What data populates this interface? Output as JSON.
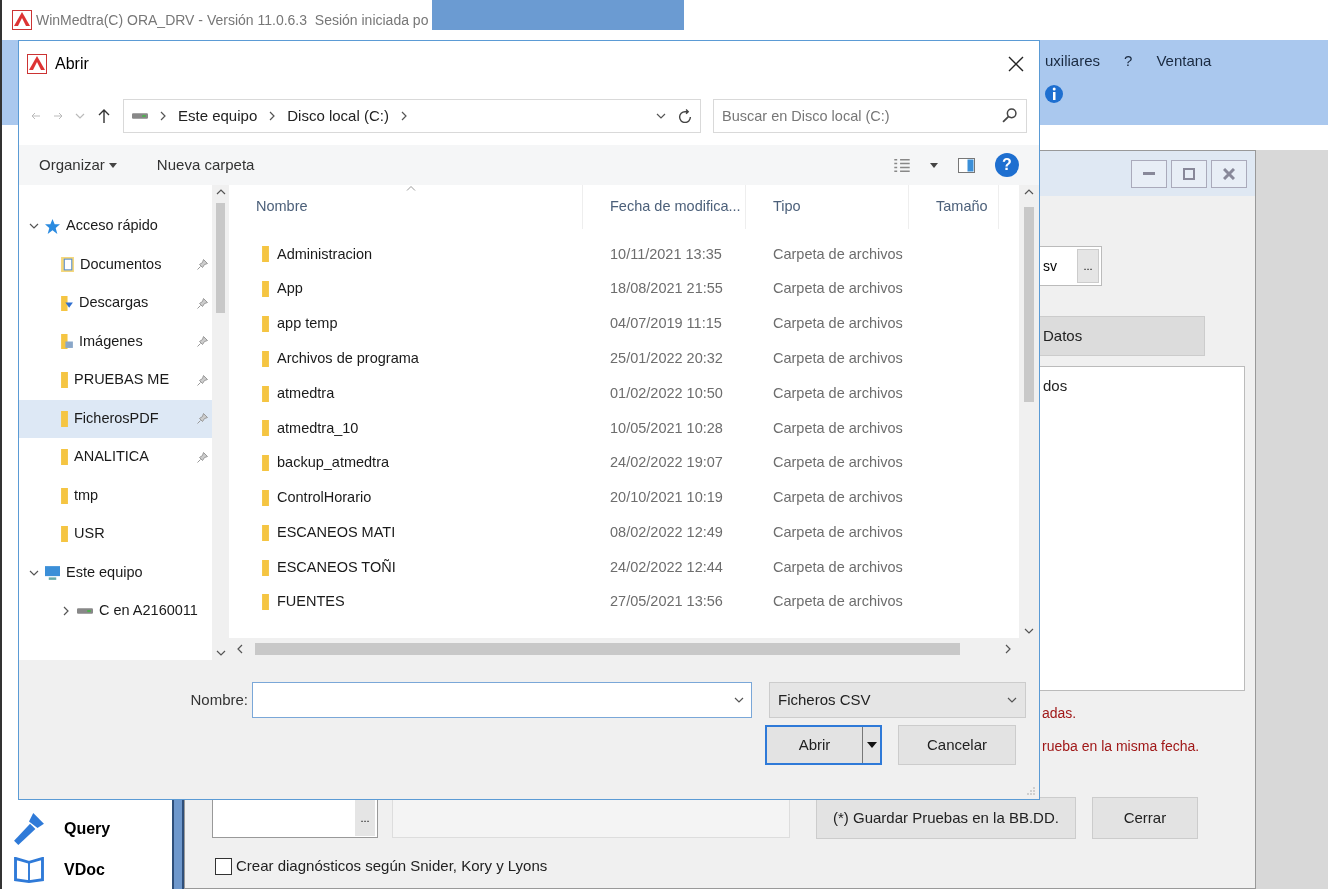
{
  "app": {
    "title": "WinMedtra(C) ORA_DRV - Versión 11.0.6.3  Sesión iniciada po",
    "menu": [
      "uxiliares",
      "?",
      "Ventana"
    ],
    "sidebar": [
      {
        "kind": "query",
        "label": "Query"
      },
      {
        "kind": "vdoc",
        "label": "VDoc"
      }
    ],
    "inner": {
      "file_field": "sv",
      "browse": "...",
      "datos": "Datos",
      "list_header": "dos",
      "notes": [
        "adas.",
        "rueba en la misma fecha."
      ],
      "bottom_browse": "...",
      "save_button": "(*) Guardar Pruebas en la BB.DD.",
      "close_button": "Cerrar",
      "checkbox": {
        "label": "Crear diagnósticos según Snider, Kory y Lyons",
        "checked": false
      }
    }
  },
  "dialog": {
    "title": "Abrir",
    "breadcrumb": [
      "Este equipo",
      "Disco local (C:)"
    ],
    "search": {
      "placeholder": "Buscar en Disco local (C:)"
    },
    "toolbar": [
      "Organizar",
      "Nueva carpeta"
    ],
    "nav": [
      {
        "label": "Acceso rápido",
        "kind": "star",
        "expanded": true,
        "children": [
          {
            "label": "Documentos",
            "kind": "documents",
            "pinned": true,
            "selected": false
          },
          {
            "label": "Descargas",
            "kind": "downloads",
            "pinned": true,
            "selected": false
          },
          {
            "label": "Imágenes",
            "kind": "pictures",
            "pinned": true,
            "selected": false
          },
          {
            "label": "PRUEBAS ME",
            "kind": "folder",
            "pinned": true,
            "selected": false
          },
          {
            "label": "FicherosPDF",
            "kind": "folder",
            "pinned": true,
            "selected": true
          },
          {
            "label": "ANALITICA",
            "kind": "folder",
            "pinned": true,
            "selected": false
          },
          {
            "label": "tmp",
            "kind": "folder",
            "pinned": false,
            "selected": false
          },
          {
            "label": "USR",
            "kind": "folder",
            "pinned": false,
            "selected": false
          }
        ]
      },
      {
        "label": "Este equipo",
        "kind": "computer",
        "expanded": true,
        "children": [
          {
            "label": "C en A2160011",
            "kind": "drive",
            "expanded": false,
            "selected": false
          }
        ]
      }
    ],
    "columns": [
      {
        "label": "Nombre",
        "sorted": true
      },
      {
        "label": "Fecha de modifica...",
        "sorted": false
      },
      {
        "label": "Tipo",
        "sorted": false
      },
      {
        "label": "Tamaño",
        "sorted": false
      }
    ],
    "rows": [
      {
        "name": "Administracion",
        "date": "10/11/2021 13:35",
        "type": "Carpeta de archivos"
      },
      {
        "name": "App",
        "date": "18/08/2021 21:55",
        "type": "Carpeta de archivos"
      },
      {
        "name": "app temp",
        "date": "04/07/2019 11:15",
        "type": "Carpeta de archivos"
      },
      {
        "name": "Archivos de programa",
        "date": "25/01/2022 20:32",
        "type": "Carpeta de archivos"
      },
      {
        "name": "atmedtra",
        "date": "01/02/2022 10:50",
        "type": "Carpeta de archivos"
      },
      {
        "name": "atmedtra_10",
        "date": "10/05/2021 10:28",
        "type": "Carpeta de archivos"
      },
      {
        "name": "backup_atmedtra",
        "date": "24/02/2022 19:07",
        "type": "Carpeta de archivos"
      },
      {
        "name": "ControlHorario",
        "date": "20/10/2021 10:19",
        "type": "Carpeta de archivos"
      },
      {
        "name": "ESCANEOS MATI",
        "date": "08/02/2022 12:49",
        "type": "Carpeta de archivos"
      },
      {
        "name": "ESCANEOS TOÑI",
        "date": "24/02/2022 12:44",
        "type": "Carpeta de archivos"
      },
      {
        "name": "FUENTES",
        "date": "27/05/2021 13:56",
        "type": "Carpeta de archivos"
      }
    ],
    "filename": {
      "label": "Nombre:"
    },
    "help": "?",
    "filetype": "Ficheros CSV",
    "buttons": [
      "Abrir",
      "Cancelar"
    ]
  }
}
